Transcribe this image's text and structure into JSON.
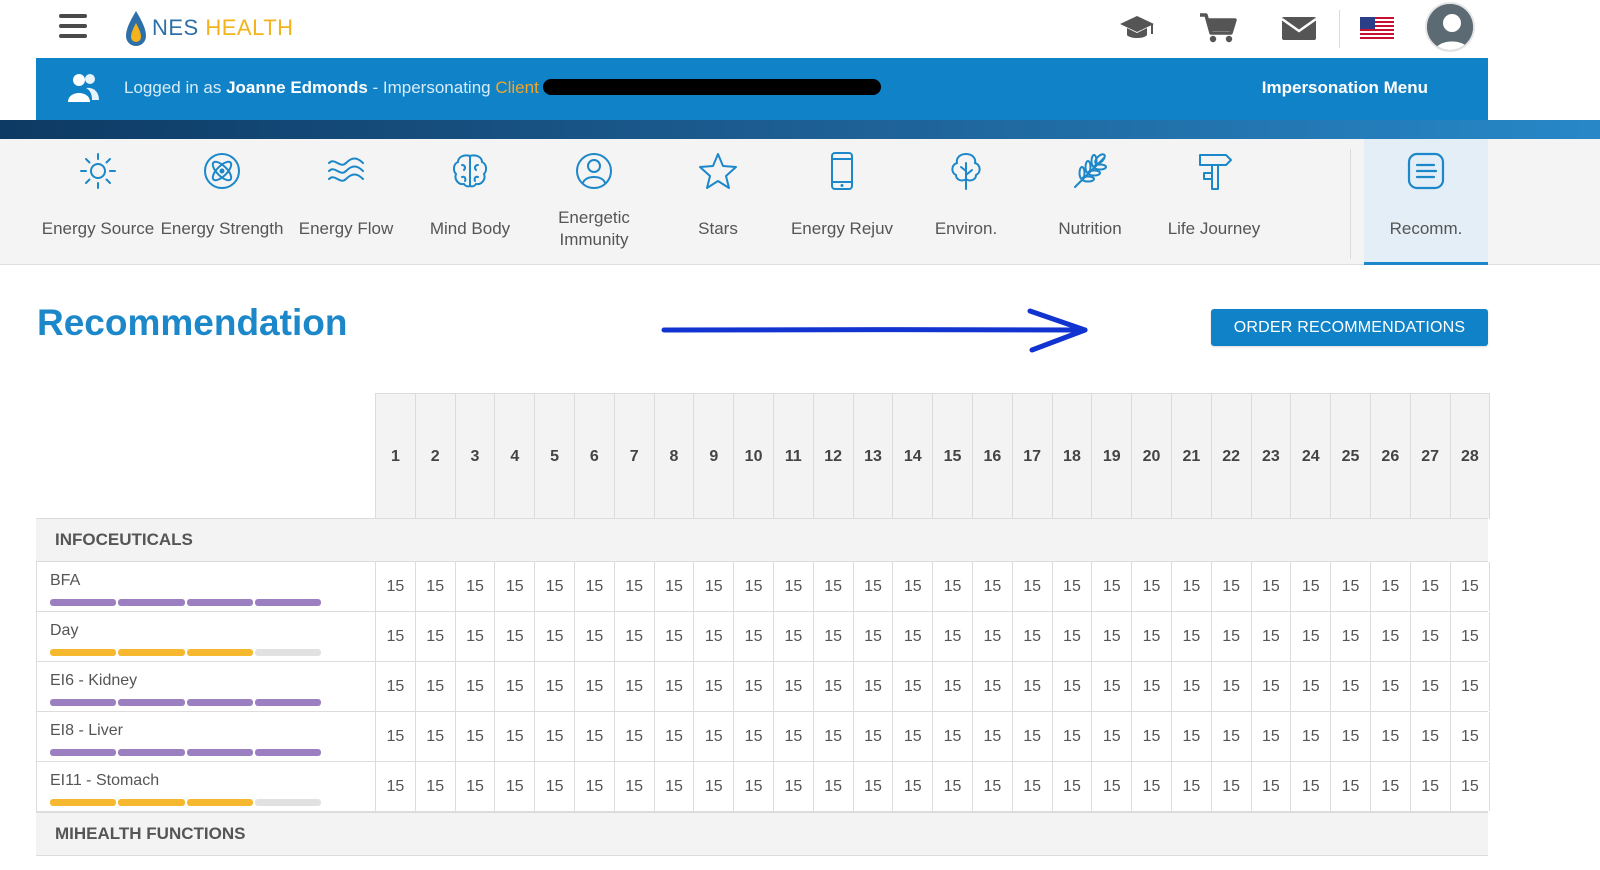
{
  "header": {
    "logo_nes": "NES",
    "logo_health": "HEALTH",
    "icons": [
      "graduation-cap-icon",
      "cart-icon",
      "mail-icon",
      "us-flag-icon",
      "user-avatar-icon"
    ]
  },
  "impersonation": {
    "prefix": "Logged in as ",
    "user": "Joanne Edmonds",
    "middle": " - Impersonating ",
    "client_label": "Client",
    "menu_label": "Impersonation Menu"
  },
  "nav": {
    "items": [
      {
        "label": "Energy Source",
        "icon": "sun-icon"
      },
      {
        "label": "Energy Strength",
        "icon": "atom-icon"
      },
      {
        "label": "Energy Flow",
        "icon": "waves-icon"
      },
      {
        "label": "Mind Body",
        "icon": "brain-icon"
      },
      {
        "label": "Energetic Immunity",
        "icon": "person-circle-icon"
      },
      {
        "label": "Stars",
        "icon": "star-icon"
      },
      {
        "label": "Energy Rejuv",
        "icon": "phone-icon"
      },
      {
        "label": "Environ.",
        "icon": "tree-icon"
      },
      {
        "label": "Nutrition",
        "icon": "wheat-icon"
      },
      {
        "label": "Life Journey",
        "icon": "signpost-icon"
      },
      {
        "label": "Recomm.",
        "icon": "document-list-icon",
        "active": true
      }
    ]
  },
  "main": {
    "title": "Recommendation",
    "order_button": "ORDER RECOMMENDATIONS"
  },
  "table": {
    "days": [
      "1",
      "2",
      "3",
      "4",
      "5",
      "6",
      "7",
      "8",
      "9",
      "10",
      "11",
      "12",
      "13",
      "14",
      "15",
      "16",
      "17",
      "18",
      "19",
      "20",
      "21",
      "22",
      "23",
      "24",
      "25",
      "26",
      "27",
      "28"
    ],
    "sections": [
      {
        "title": "INFOCEUTICALS",
        "rows": [
          {
            "name": "BFA",
            "bar_color": "#9b7fc1",
            "bar_level": 4,
            "value": "15"
          },
          {
            "name": "Day",
            "bar_color": "#f5b82e",
            "bar_level": 3,
            "value": "15"
          },
          {
            "name": "EI6 - Kidney",
            "bar_color": "#9b7fc1",
            "bar_level": 4,
            "value": "15"
          },
          {
            "name": "EI8 - Liver",
            "bar_color": "#9b7fc1",
            "bar_level": 4,
            "value": "15"
          },
          {
            "name": "EI11 - Stomach",
            "bar_color": "#f5b82e",
            "bar_level": 3,
            "value": "15"
          }
        ]
      },
      {
        "title": "MIHEALTH FUNCTIONS",
        "rows": []
      }
    ]
  }
}
